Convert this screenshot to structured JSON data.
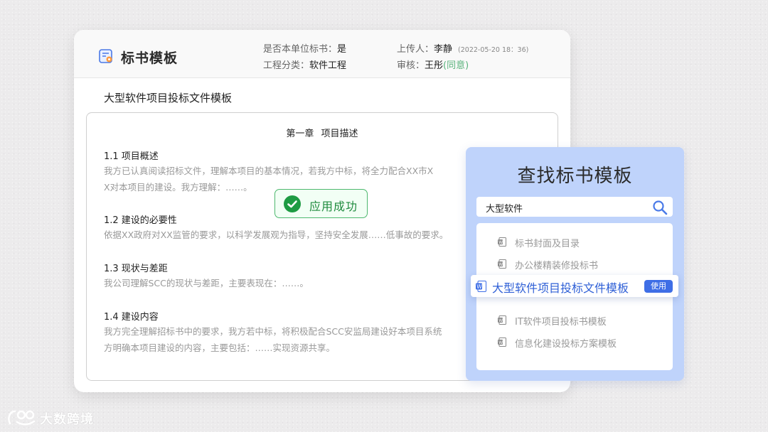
{
  "header": {
    "title": "标书模板",
    "is_unit_bid_label": "是否本单位标书：",
    "is_unit_bid_value": "是",
    "category_label": "工程分类：",
    "category_value": "软件工程",
    "uploader_label": "上传人：",
    "uploader_value": "李静",
    "upload_time": "(2022-05-20 18：36)",
    "reviewer_label": "审核：",
    "reviewer_value": "王彤",
    "review_status": "(同意)"
  },
  "document": {
    "title": "大型软件项目投标文件模板",
    "chapter": "第一章 项目描述",
    "sections": [
      {
        "heading": "1.1  项目概述",
        "lines": [
          "我方已认真阅读招标文件，理解本项目的基本情况，若我方中标，将全力配合XX市X",
          "X对本项目的建设。我方理解：……。"
        ]
      },
      {
        "heading": "1.2  建设的必要性",
        "lines": [
          "依据XX政府对XX监管的要求，以科学发展观为指导，坚持安全发展……低事故的要求。"
        ]
      },
      {
        "heading": "1.3  现状与差距",
        "lines": [
          "我公司理解SCC的现状与差距，主要表现在：……。"
        ]
      },
      {
        "heading": "1.4  建设内容",
        "lines": [
          "我方完全理解招标书中的要求，我方若中标，将积极配合SCC安监局建设好本项目系统",
          "方明确本项目建设的内容，主要包括：……实现资源共享。"
        ]
      }
    ]
  },
  "toast": {
    "label": "应用成功"
  },
  "search_panel": {
    "title": "查找标书模板",
    "query": "大型软件",
    "results": [
      {
        "label": "标书封面及目录"
      },
      {
        "label": "办公楼精装修投标书"
      },
      {
        "label": "大型软件项目投标文件模板",
        "use_label": "使用"
      },
      {
        "label": "IT软件项目投标书模板"
      },
      {
        "label": "信息化建设投标方案模板"
      }
    ]
  },
  "logo": {
    "text": "大数跨境"
  },
  "colors": {
    "accent_blue": "#3e6ee6",
    "panel_bg": "#bfd3fb",
    "success_green": "#1e9b43",
    "approved_green": "#59b37b"
  }
}
